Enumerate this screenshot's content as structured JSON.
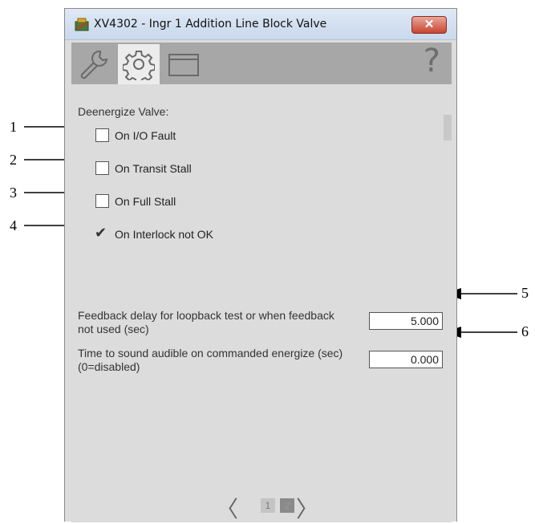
{
  "window": {
    "title": "XV4302 - Ingr 1 Addition Line Block Valve",
    "close_glyph": "✕"
  },
  "toolbar": {
    "tabs": [
      {
        "name": "wrench-icon",
        "selected": false
      },
      {
        "name": "gear-icon",
        "selected": true
      },
      {
        "name": "window-icon",
        "selected": false
      }
    ],
    "help_glyph": "?"
  },
  "section": {
    "label": "Deenergize Valve:"
  },
  "options": [
    {
      "label": "On I/O Fault",
      "checked": false,
      "callout": "1"
    },
    {
      "label": "On Transit Stall",
      "checked": false,
      "callout": "2"
    },
    {
      "label": "On Full Stall",
      "checked": false,
      "callout": "3"
    },
    {
      "label": "On Interlock not OK",
      "checked": true,
      "callout": "4"
    }
  ],
  "checkmark_glyph": "✔",
  "params": [
    {
      "label": "Feedback delay for loopback test or when feedback not used (sec)",
      "value": "5.000",
      "callout": "5"
    },
    {
      "label": "Time to sound audible on commanded energize (sec) (0=disabled)",
      "value": "0.000",
      "callout": "6"
    }
  ],
  "pager": {
    "prev": "〈",
    "next": "〉",
    "pages": [
      "1",
      "2"
    ],
    "current": "2"
  },
  "colors": {
    "close": "#c9452f",
    "selected_tab": "#ececec",
    "toolbar": "#a7a7a7",
    "panel": "#dcdcdc"
  }
}
